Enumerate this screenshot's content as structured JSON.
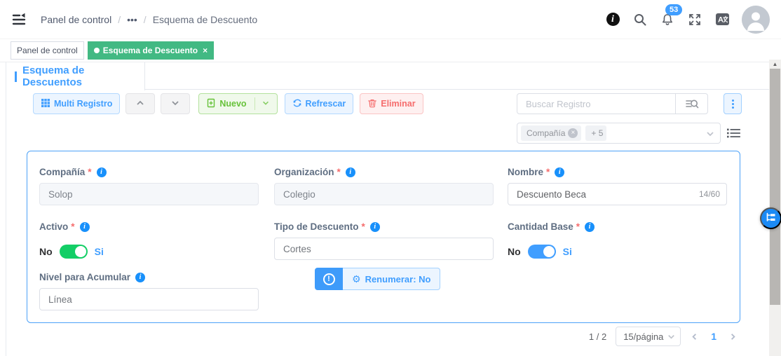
{
  "colors": {
    "accent": "#409eff",
    "tab_active_green": "#42b983",
    "switch_on_green": "#13ce66",
    "switch_on_blue": "#409eff",
    "danger": "#f56c6c",
    "success": "#67c23a",
    "badge_blue": "#409eff",
    "fab_blue": "#1b8af5"
  },
  "navbar": {
    "breadcrumb": [
      "Panel de control",
      "•••",
      "Esquema de Descuento"
    ],
    "separator": "/",
    "notification_count": "53"
  },
  "tags_view": {
    "tabs": [
      {
        "label": "Panel de control"
      },
      {
        "label": "Esquema de Descuento",
        "close": "×"
      }
    ]
  },
  "panel": {
    "title": "Esquema de Descuentos"
  },
  "toolbar": {
    "multi_record_label": "Multi Registro",
    "new_label": "Nuevo",
    "refresh_label": "Refrescar",
    "delete_label": "Eliminar",
    "search_placeholder": "Buscar Registro"
  },
  "field_filter": {
    "tags": [
      "Compañía",
      "+ 5"
    ],
    "tag_close": "×"
  },
  "required_marker": "*",
  "form": {
    "company": {
      "label": "Compañía",
      "value": "Solop"
    },
    "organization": {
      "label": "Organización",
      "value": "Colegio"
    },
    "name": {
      "label": "Nombre",
      "value": "Descuento Beca",
      "counter": "14/60"
    },
    "active": {
      "label": "Activo",
      "off": "No",
      "on": "Si"
    },
    "discount_type": {
      "label": "Tipo de Descuento",
      "value": "Cortes"
    },
    "base_quantity": {
      "label": "Cantidad Base",
      "off": "No",
      "on": "Si"
    },
    "accumulation_level": {
      "label": "Nivel para Acumular",
      "value": "Línea"
    },
    "renumber": {
      "label": "Renumerar: No",
      "alert": "!",
      "gear": "⚙"
    }
  },
  "pagination": {
    "total": "1 / 2",
    "page_size": "15/página",
    "current_page": "1"
  }
}
